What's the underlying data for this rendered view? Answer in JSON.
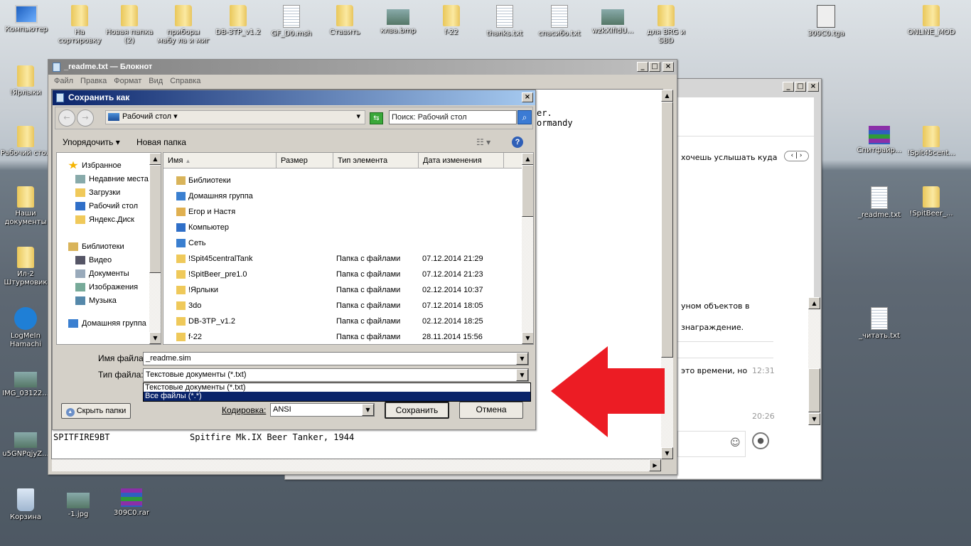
{
  "desktop": {
    "top_icons": [
      {
        "label": "Компьютер",
        "type": "computer"
      },
      {
        "label": "На сортировку",
        "type": "folder"
      },
      {
        "label": "Новая папка (2)",
        "type": "folder"
      },
      {
        "label": "приборы мабу ла и миг",
        "type": "folder"
      },
      {
        "label": "DB-3TP_v1.2",
        "type": "folder"
      },
      {
        "label": "GF_D0.msh",
        "type": "file"
      },
      {
        "label": "Ставить",
        "type": "folder"
      },
      {
        "label": "клва.bmp",
        "type": "image"
      },
      {
        "label": "f-22",
        "type": "folder"
      },
      {
        "label": "thanks.txt",
        "type": "text"
      },
      {
        "label": "спасибо.txt",
        "type": "text"
      },
      {
        "label": "wzkXIfIdU...",
        "type": "image"
      },
      {
        "label": "для BRG и SBD",
        "type": "folder"
      },
      {
        "label": "309C0.tga",
        "type": "gimp"
      },
      {
        "label": "ONLINE_MOD",
        "type": "folder"
      }
    ],
    "left_icons": [
      {
        "label": "!Ярлыки",
        "type": "folder"
      },
      {
        "label": "Рабочий стол",
        "type": "folder"
      },
      {
        "label": "Наши документы",
        "type": "folder"
      },
      {
        "label": "Ил-2 Штурмовик",
        "type": "folder"
      },
      {
        "label": "LogMeIn Hamachi",
        "type": "hamachi"
      },
      {
        "label": "IMG_03122...",
        "type": "image"
      },
      {
        "label": "u5GNPqjyZ...",
        "type": "image"
      },
      {
        "label": "Корзина",
        "type": "trash"
      }
    ],
    "bottom_icons": [
      {
        "label": "-1.jpg",
        "type": "image"
      },
      {
        "label": "309C0.rar",
        "type": "rar"
      }
    ],
    "right_icons": [
      {
        "label": "Спитфайр...",
        "type": "rar"
      },
      {
        "label": "!Spit45cent...",
        "type": "folder"
      },
      {
        "label": "_readme.txt",
        "type": "text"
      },
      {
        "label": "!SpitBeer_...",
        "type": "folder"
      },
      {
        "label": "_читать.txt",
        "type": "text"
      }
    ]
  },
  "chat_window": {
    "messages": [
      "хочешь услышать куда",
      "уном объектов в",
      "знаграждение.",
      "это времени, но",
      "12:31",
      "20:26"
    ]
  },
  "notepad": {
    "title": "_readme.txt — Блокнот",
    "menu": [
      "Файл",
      "Правка",
      "Формат",
      "Вид",
      "Справка"
    ],
    "text_visible": [
      "er.",
      "ormandy"
    ],
    "bottom_line_1": "SPITFIRE9BT",
    "bottom_line_2": "Spitfire Mk.IX Beer Tanker, 1944"
  },
  "dialog": {
    "title": "Сохранить как",
    "location": "Рабочий стол",
    "search_placeholder": "Поиск: Рабочий стол",
    "organize": "Упорядочить",
    "new_folder": "Новая папка",
    "nav": [
      {
        "label": "Избранное",
        "icon": "star"
      },
      {
        "label": "Недавние места",
        "icon": "recent"
      },
      {
        "label": "Загрузки",
        "icon": "downloads"
      },
      {
        "label": "Рабочий стол",
        "icon": "desktop"
      },
      {
        "label": "Яндекс.Диск",
        "icon": "yadisk"
      },
      {
        "label": "Библиотеки",
        "icon": "libraries"
      },
      {
        "label": "Видео",
        "icon": "video"
      },
      {
        "label": "Документы",
        "icon": "documents"
      },
      {
        "label": "Изображения",
        "icon": "images"
      },
      {
        "label": "Музыка",
        "icon": "music"
      },
      {
        "label": "Домашняя группа",
        "icon": "homegroup"
      }
    ],
    "columns": [
      "Имя",
      "Размер",
      "Тип элемента",
      "Дата изменения"
    ],
    "files": [
      {
        "name": "Библиотеки",
        "type": "",
        "date": "",
        "icon": "libraries"
      },
      {
        "name": "Домашняя группа",
        "type": "",
        "date": "",
        "icon": "homegroup"
      },
      {
        "name": "Егор и Настя",
        "type": "",
        "date": "",
        "icon": "user-folder"
      },
      {
        "name": "Компьютер",
        "type": "",
        "date": "",
        "icon": "computer"
      },
      {
        "name": "Сеть",
        "type": "",
        "date": "",
        "icon": "network"
      },
      {
        "name": "!Spit45centralTank",
        "type": "Папка с файлами",
        "date": "07.12.2014 21:29",
        "icon": "folder"
      },
      {
        "name": "!SpitBeer_pre1.0",
        "type": "Папка с файлами",
        "date": "07.12.2014 21:23",
        "icon": "folder"
      },
      {
        "name": "!Ярлыки",
        "type": "Папка с файлами",
        "date": "02.12.2014 10:37",
        "icon": "folder"
      },
      {
        "name": "3do",
        "type": "Папка с файлами",
        "date": "07.12.2014 18:05",
        "icon": "folder"
      },
      {
        "name": "DB-3TP_v1.2",
        "type": "Папка с файлами",
        "date": "02.12.2014 18:25",
        "icon": "folder"
      },
      {
        "name": "f-22",
        "type": "Папка с файлами",
        "date": "28.11.2014 15:56",
        "icon": "folder"
      }
    ],
    "filename_label": "Имя файла:",
    "filename_value": "_readme.sim",
    "filetype_label": "Тип файла:",
    "filetype_value": "Текстовые документы (*.txt)",
    "filetype_options": [
      "Текстовые документы (*.txt)",
      "Все файлы  (*.*)"
    ],
    "filetype_highlighted": 1,
    "hide_folders": "Скрыть папки",
    "encoding_label": "Кодировка:",
    "encoding_value": "ANSI",
    "save": "Сохранить",
    "cancel": "Отмена"
  },
  "annotation": {
    "arrow_color": "#ec1c24"
  }
}
